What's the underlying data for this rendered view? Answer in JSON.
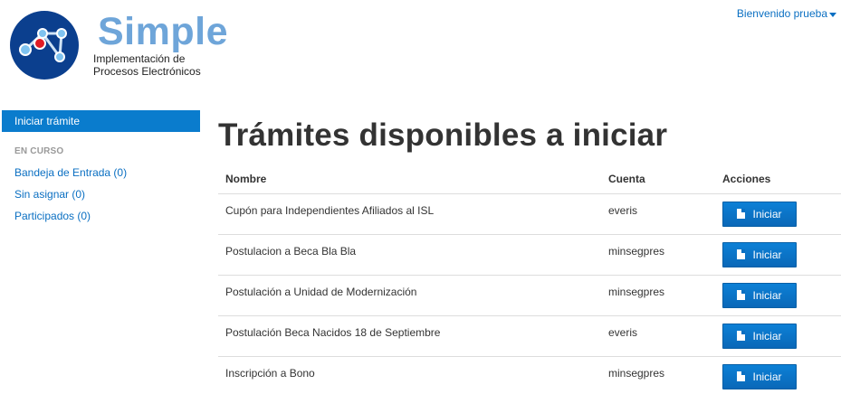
{
  "brand": {
    "name": "Simple",
    "subtitle_line1": "Implementación de",
    "subtitle_line2": "Procesos Electrónicos",
    "logo_icon": "molecule-network-icon"
  },
  "user_menu": {
    "label": "Bienvenido prueba"
  },
  "sidebar": {
    "active_item": "Iniciar trámite",
    "section_header": "EN CURSO",
    "items": [
      {
        "label": "Bandeja de Entrada (0)"
      },
      {
        "label": "Sin asignar (0)"
      },
      {
        "label": "Participados (0)"
      }
    ]
  },
  "main": {
    "title": "Trámites disponibles a iniciar",
    "table": {
      "headers": {
        "nombre": "Nombre",
        "cuenta": "Cuenta",
        "acciones": "Acciones"
      },
      "rows": [
        {
          "nombre": "Cupón para Independientes Afiliados al ISL",
          "cuenta": "everis",
          "action": "Iniciar"
        },
        {
          "nombre": "Postulacion a Beca Bla Bla",
          "cuenta": "minsegpres",
          "action": "Iniciar"
        },
        {
          "nombre": "Postulación a Unidad de Modernización",
          "cuenta": "minsegpres",
          "action": "Iniciar"
        },
        {
          "nombre": "Postulación Beca Nacidos 18 de Septiembre",
          "cuenta": "everis",
          "action": "Iniciar"
        },
        {
          "nombre": "Inscripción a Bono",
          "cuenta": "minsegpres",
          "action": "Iniciar"
        }
      ]
    }
  },
  "colors": {
    "accent": "#0a7ccd",
    "link": "#0a6fc2",
    "logo_text": "#6ea5d9",
    "logo_circle": "#0b3f8e"
  }
}
